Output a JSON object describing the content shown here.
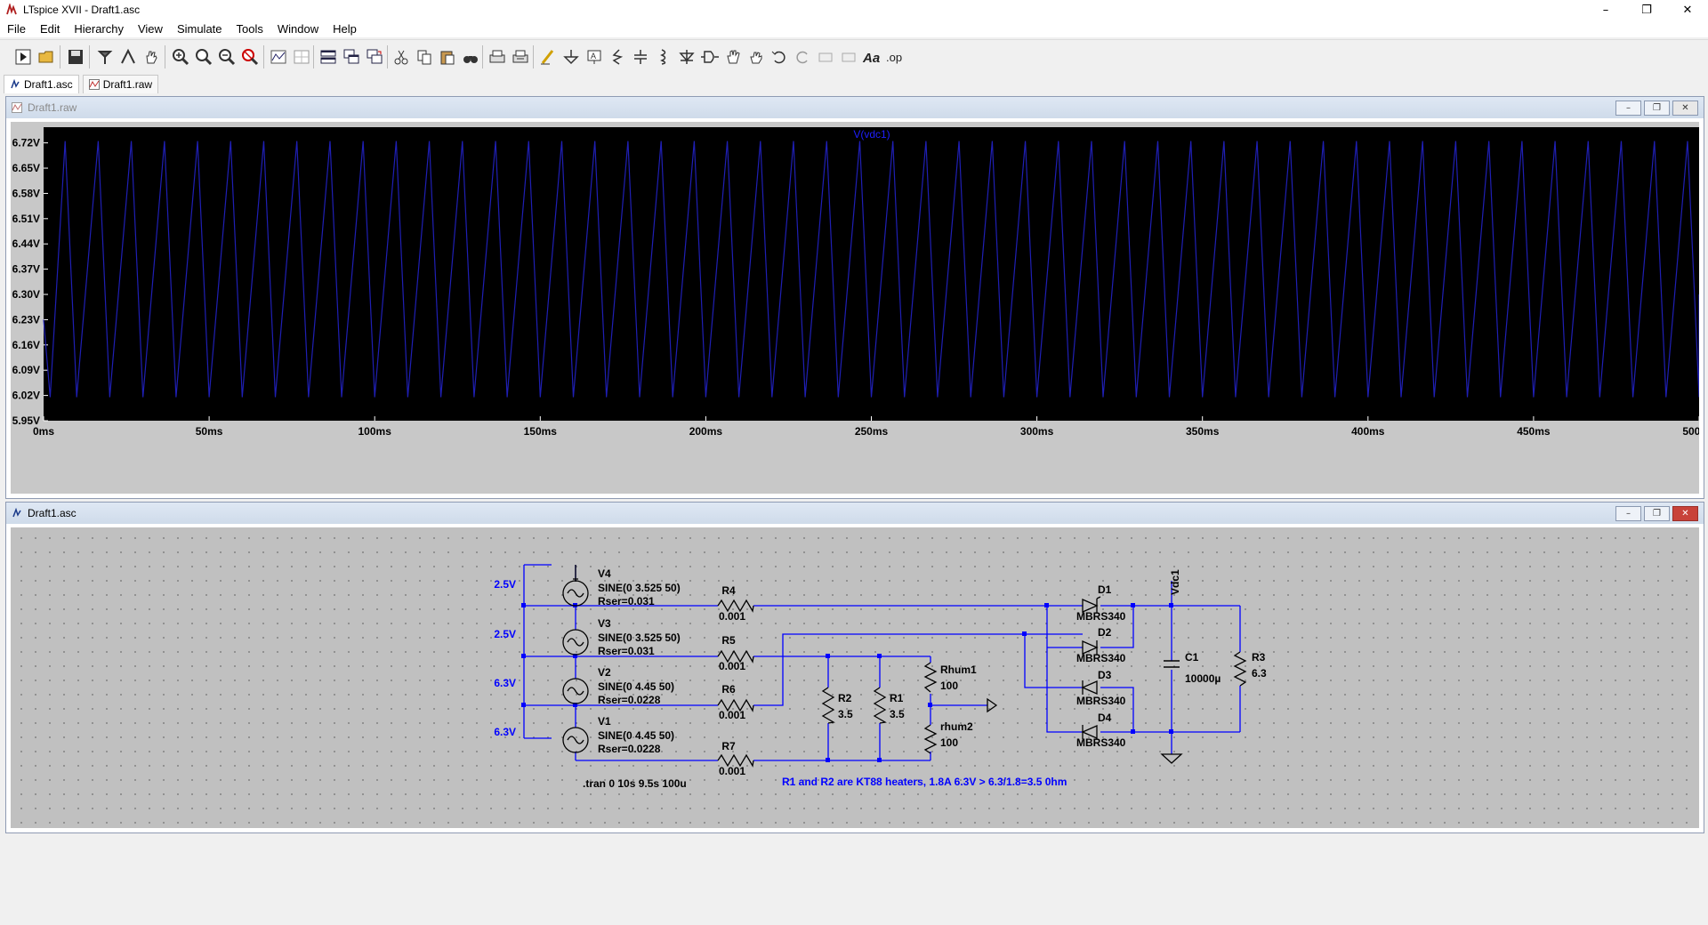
{
  "window": {
    "title": "LTspice XVII - Draft1.asc"
  },
  "menu": [
    "File",
    "Edit",
    "Hierarchy",
    "View",
    "Simulate",
    "Tools",
    "Window",
    "Help"
  ],
  "tabs": [
    {
      "label": "Draft1.asc",
      "icon": "schematic-icon",
      "active": true
    },
    {
      "label": "Draft1.raw",
      "icon": "waveform-icon",
      "active": false
    }
  ],
  "raw_window": {
    "title": "Draft1.raw"
  },
  "asc_window": {
    "title": "Draft1.asc"
  },
  "chart_data": {
    "type": "line",
    "title": "V(vdc1)",
    "xlabel": "",
    "ylabel": "",
    "x_ticks": [
      "0ms",
      "50ms",
      "100ms",
      "150ms",
      "200ms",
      "250ms",
      "300ms",
      "350ms",
      "400ms",
      "450ms",
      "500ms"
    ],
    "y_ticks": [
      "6.72V",
      "6.65V",
      "6.58V",
      "6.51V",
      "6.44V",
      "6.37V",
      "6.30V",
      "6.23V",
      "6.16V",
      "6.09V",
      "6.02V",
      "5.95V"
    ],
    "xlim": [
      0,
      500
    ],
    "ylim": [
      5.95,
      6.77
    ],
    "series": [
      {
        "name": "V(vdc1)",
        "color": "#1f1fb4",
        "period_ms": 10,
        "peak_offset_ms": 6.5,
        "max": 6.725,
        "min": 6.015
      }
    ],
    "grid": false,
    "background": "#000000"
  },
  "schematic": {
    "sources": [
      {
        "name": "V4",
        "value": "SINE(0 3.525 50)",
        "rser": "Rser=0.031",
        "label": "2.5V"
      },
      {
        "name": "V3",
        "value": "SINE(0 3.525 50)",
        "rser": "Rser=0.031",
        "label": "2.5V"
      },
      {
        "name": "V2",
        "value": "SINE(0 4.45 50)",
        "rser": "Rser=0.0228",
        "label": "6.3V"
      },
      {
        "name": "V1",
        "value": "SINE(0 4.45 50)",
        "rser": "Rser=0.0228",
        "label": "6.3V"
      }
    ],
    "resistors": [
      {
        "name": "R4",
        "value": "0.001"
      },
      {
        "name": "R5",
        "value": "0.001"
      },
      {
        "name": "R6",
        "value": "0.001"
      },
      {
        "name": "R7",
        "value": "0.001"
      },
      {
        "name": "R2",
        "value": "3.5"
      },
      {
        "name": "R1",
        "value": "3.5"
      },
      {
        "name": "Rhum1",
        "value": "100"
      },
      {
        "name": "rhum2",
        "value": "100"
      },
      {
        "name": "R3",
        "value": "6.3"
      }
    ],
    "diodes": [
      {
        "name": "D1",
        "model": "MBRS340"
      },
      {
        "name": "D2",
        "model": "MBRS340"
      },
      {
        "name": "D3",
        "model": "MBRS340"
      },
      {
        "name": "D4",
        "model": "MBRS340"
      }
    ],
    "capacitor": {
      "name": "C1",
      "value": "10000µ"
    },
    "net_label": "Vdc1",
    "directive": ".tran 0 10s 9.5s 100u",
    "comment": "R1 and R2 are KT88 heaters, 1.8A 6.3V > 6.3/1.8=3.5 0hm"
  },
  "colors": {
    "wire": "#0000ff",
    "component": "#000000",
    "comment": "#0000ff",
    "sch_bg": "#c0c0c0",
    "plot_bg": "#000000",
    "trace": "#1f1fb4"
  }
}
